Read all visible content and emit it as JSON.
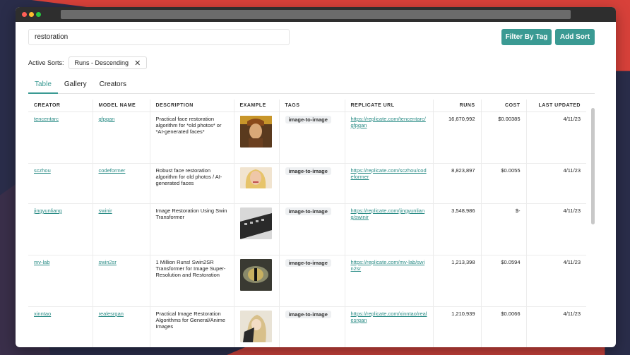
{
  "search": {
    "value": "restoration"
  },
  "toolbar": {
    "filter_label": "Filter By Tag",
    "sort_label": "Add Sort"
  },
  "sorts": {
    "label": "Active Sorts:",
    "chip": "Runs - Descending",
    "close_glyph": "✕"
  },
  "tabs": [
    "Table",
    "Gallery",
    "Creators"
  ],
  "columns": [
    "CREATOR",
    "MODEL NAME",
    "DESCRIPTION",
    "EXAMPLE",
    "TAGS",
    "REPLICATE URL",
    "RUNS",
    "COST",
    "LAST UPDATED"
  ],
  "rows": [
    {
      "creator": "tencentarc",
      "model": "gfpgan",
      "description": "Practical face restoration algorithm for *old photos* or *AI-generated faces*",
      "tag": "image-to-image",
      "url": "https://replicate.com/tencentarc/gfpgan",
      "runs": "16,670,992",
      "cost": "$0.00385",
      "updated": "4/11/23"
    },
    {
      "creator": "sczhou",
      "model": "codeformer",
      "description": "Robust face restoration algorithm for old photos / AI-generated faces",
      "tag": "image-to-image",
      "url": "https://replicate.com/sczhou/codeformer",
      "runs": "8,823,897",
      "cost": "$0.0055",
      "updated": "4/11/23"
    },
    {
      "creator": "jingyunliang",
      "model": "swinir",
      "description": "Image Restoration Using Swin Transformer",
      "tag": "image-to-image",
      "url": "https://replicate.com/jingyunliang/swinir",
      "runs": "3,548,986",
      "cost": "$-",
      "updated": "4/11/23"
    },
    {
      "creator": "mv-lab",
      "model": "swin2sr",
      "description": "1 Million Runs! Swin2SR Transformer for Image Super-Resolution and Restoration",
      "tag": "image-to-image",
      "url": "https://replicate.com/mv-lab/swin2sr",
      "runs": "1,213,398",
      "cost": "$0.0594",
      "updated": "4/11/23"
    },
    {
      "creator": "xinntao",
      "model": "realesrgan",
      "description": "Practical Image Restoration Algorithms for General/Anime Images",
      "tag": "image-to-image",
      "url": "https://replicate.com/xinntao/realesrgan",
      "runs": "1,210,939",
      "cost": "$0.0066",
      "updated": "4/11/23"
    }
  ]
}
